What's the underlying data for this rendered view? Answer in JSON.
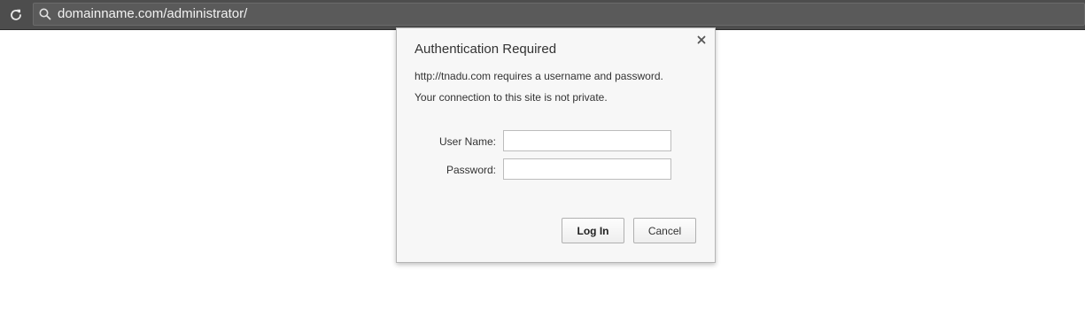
{
  "browser": {
    "url": "domainname.com/administrator/",
    "icons": {
      "reload": "reload-icon",
      "search": "search-icon"
    },
    "colors": {
      "toolbar": "#4d4d4d",
      "omnibox": "#5a5a5a",
      "url_text": "#f2f2f2"
    }
  },
  "dialog": {
    "title": "Authentication Required",
    "message_line1": "http://tnadu.com requires a username and password.",
    "message_line2": "Your connection to this site is not private.",
    "close_icon": "close-icon",
    "fields": {
      "username_label": "User Name:",
      "username_value": "",
      "password_label": "Password:",
      "password_value": ""
    },
    "buttons": {
      "login": "Log In",
      "cancel": "Cancel"
    },
    "colors": {
      "background": "#f7f7f7",
      "border": "#b5b5b5"
    }
  }
}
